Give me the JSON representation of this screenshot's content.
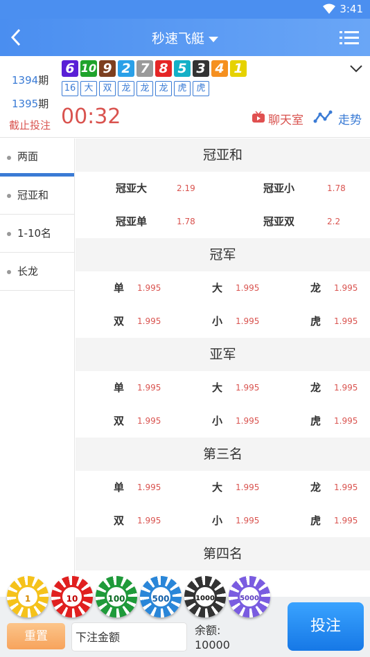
{
  "status_bar": {
    "time": "3:41"
  },
  "header": {
    "title": "秒速飞艇",
    "dropdown_icon": "caret-down-icon",
    "menu_icon": "list-icon"
  },
  "draw": {
    "prev_period_num": "1394",
    "prev_period_unit": "期",
    "numbers": [
      {
        "value": "6",
        "color": "#5a1fd6"
      },
      {
        "value": "10",
        "color": "#1fa32b"
      },
      {
        "value": "9",
        "color": "#7d3f1f"
      },
      {
        "value": "2",
        "color": "#2aa0e8"
      },
      {
        "value": "7",
        "color": "#9a9a9a"
      },
      {
        "value": "8",
        "color": "#e52626"
      },
      {
        "value": "5",
        "color": "#14b0c7"
      },
      {
        "value": "3",
        "color": "#333333"
      },
      {
        "value": "4",
        "color": "#f59020"
      },
      {
        "value": "1",
        "color": "#e6d200"
      }
    ],
    "tags": [
      "16",
      "大",
      "双",
      "龙",
      "龙",
      "龙",
      "虎",
      "虎"
    ],
    "next_period_num": "1395",
    "next_period_unit": "期",
    "deadline_label": "截止投注",
    "countdown": "00:32",
    "chat_label": "聊天室",
    "trend_label": "走势"
  },
  "sidebar": {
    "items": [
      {
        "label": "两面",
        "active": true
      },
      {
        "label": "冠亚和",
        "active": false
      },
      {
        "label": "1-10名",
        "active": false
      },
      {
        "label": "长龙",
        "active": false
      }
    ]
  },
  "sections": [
    {
      "title": "冠亚和",
      "rows": [
        [
          {
            "label": "冠亚大",
            "odds": "2.19"
          },
          {
            "label": "冠亚小",
            "odds": "1.78"
          }
        ],
        [
          {
            "label": "冠亚单",
            "odds": "1.78"
          },
          {
            "label": "冠亚双",
            "odds": "2.2"
          }
        ]
      ]
    },
    {
      "title": "冠军",
      "rows": [
        [
          {
            "label": "单",
            "odds": "1.995"
          },
          {
            "label": "大",
            "odds": "1.995"
          },
          {
            "label": "龙",
            "odds": "1.995"
          }
        ],
        [
          {
            "label": "双",
            "odds": "1.995"
          },
          {
            "label": "小",
            "odds": "1.995"
          },
          {
            "label": "虎",
            "odds": "1.995"
          }
        ]
      ]
    },
    {
      "title": "亚军",
      "rows": [
        [
          {
            "label": "单",
            "odds": "1.995"
          },
          {
            "label": "大",
            "odds": "1.995"
          },
          {
            "label": "龙",
            "odds": "1.995"
          }
        ],
        [
          {
            "label": "双",
            "odds": "1.995"
          },
          {
            "label": "小",
            "odds": "1.995"
          },
          {
            "label": "虎",
            "odds": "1.995"
          }
        ]
      ]
    },
    {
      "title": "第三名",
      "rows": [
        [
          {
            "label": "单",
            "odds": "1.995"
          },
          {
            "label": "大",
            "odds": "1.995"
          },
          {
            "label": "龙",
            "odds": "1.995"
          }
        ],
        [
          {
            "label": "双",
            "odds": "1.995"
          },
          {
            "label": "小",
            "odds": "1.995"
          },
          {
            "label": "虎",
            "odds": "1.995"
          }
        ]
      ]
    },
    {
      "title": "第四名",
      "rows": []
    }
  ],
  "chips": [
    {
      "value": "1",
      "color": "#f5c21b",
      "text_color": "#d48a00"
    },
    {
      "value": "10",
      "color": "#e02020",
      "text_color": "#c00000"
    },
    {
      "value": "100",
      "color": "#1f9a3a",
      "text_color": "#0c6b24"
    },
    {
      "value": "500",
      "color": "#2a86d8",
      "text_color": "#1460a8"
    },
    {
      "value": "1000",
      "color": "#333333",
      "text_color": "#111111"
    },
    {
      "value": "5000",
      "color": "#7a5ce0",
      "text_color": "#5a3cc0"
    }
  ],
  "bottom": {
    "reset_label": "重置",
    "amount_placeholder": "下注金额",
    "balance_label": "余额:",
    "balance_value": "10000",
    "bet_label": "投注"
  }
}
